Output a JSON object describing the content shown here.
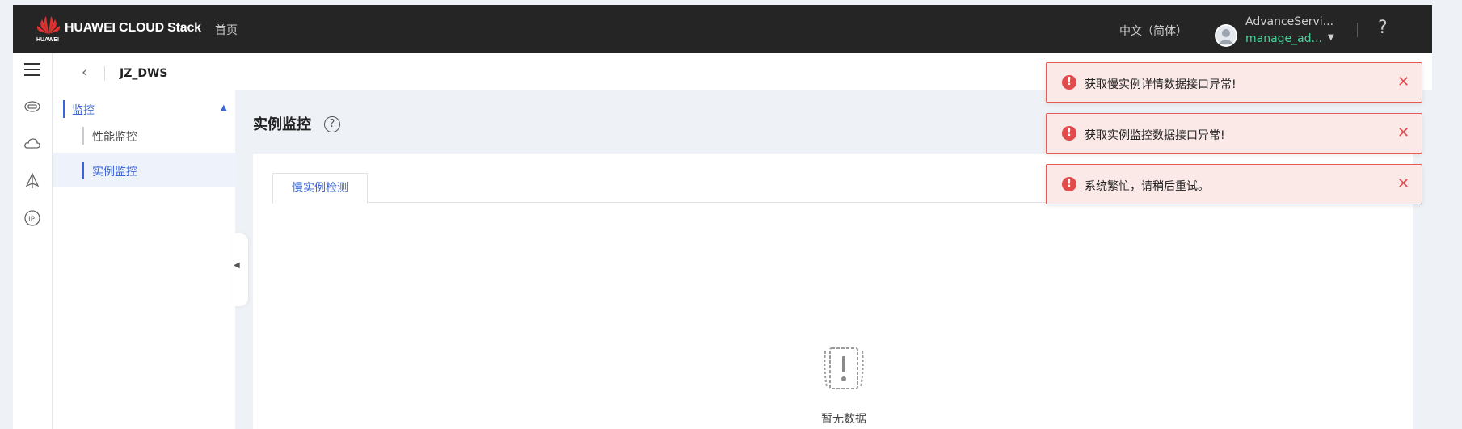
{
  "header": {
    "logo_text": "HUAWEI CLOUD Stack",
    "logo_sub": "HUAWEI",
    "home_label": "首页",
    "language": "中文（简体）",
    "user_name": "AdvanceServi...",
    "user_account": "manage_ad...",
    "help_label": "?"
  },
  "breadcrumb": {
    "back_label": "‹",
    "title": "JZ_DWS"
  },
  "sidebar": {
    "group_label": "监控",
    "items": [
      {
        "label": "性能监控"
      },
      {
        "label": "实例监控"
      }
    ]
  },
  "main": {
    "title": "实例监控",
    "help_label": "?",
    "tabs": [
      {
        "label": "慢实例检测"
      }
    ],
    "empty_text": "暂无数据"
  },
  "toasts": [
    {
      "message": "获取慢实例详情数据接口异常!"
    },
    {
      "message": "获取实例监控数据接口异常!"
    },
    {
      "message": "系统繁忙，请稍后重试。"
    }
  ],
  "colors": {
    "accent": "#3b66d9",
    "error": "#e14b4b",
    "account": "#4cd39b",
    "topbar": "#252526"
  }
}
